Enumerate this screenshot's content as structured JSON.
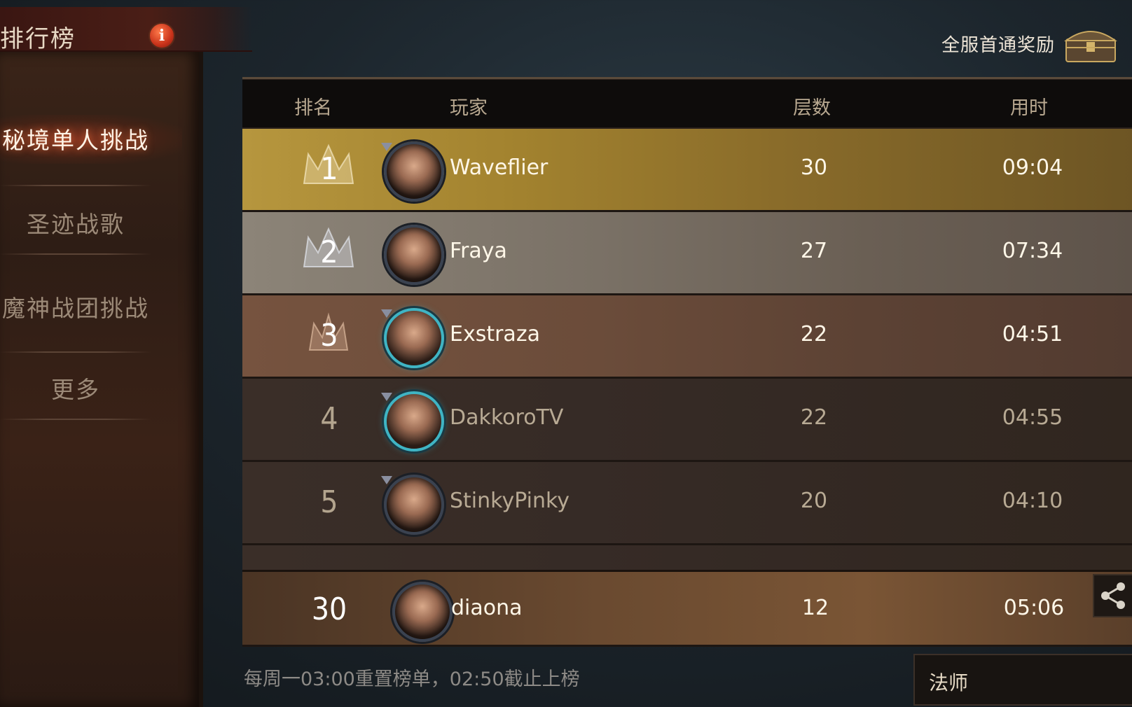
{
  "title": "排行榜",
  "reward_link": "全服首通奖励",
  "sidebar": {
    "items": [
      {
        "label": "秘境单人挑战"
      },
      {
        "label": "圣迹战歌"
      },
      {
        "label": "魔神战团挑战"
      },
      {
        "label": "更多"
      }
    ]
  },
  "table": {
    "headers": {
      "rank": "排名",
      "player": "玩家",
      "floors": "层数",
      "time": "用时"
    },
    "rows": [
      {
        "rank": "1",
        "player": "Waveflier",
        "floors": "30",
        "time": "09:04"
      },
      {
        "rank": "2",
        "player": "Fraya",
        "floors": "27",
        "time": "07:34"
      },
      {
        "rank": "3",
        "player": "Exstraza",
        "floors": "22",
        "time": "04:51"
      },
      {
        "rank": "4",
        "player": "DakkoroTV",
        "floors": "22",
        "time": "04:55"
      },
      {
        "rank": "5",
        "player": "StinkyPinky",
        "floors": "20",
        "time": "04:10"
      }
    ],
    "my_row": {
      "rank": "30",
      "player": "diaona",
      "floors": "12",
      "time": "05:06"
    }
  },
  "footer_note": "每周一03:00重置榜单，02:50截止上榜",
  "class_filter": {
    "selected": "法师"
  },
  "colors": {
    "gold": "#b6963e",
    "silver": "#8c8478",
    "bronze": "#76533f",
    "accent_red": "#c8321a"
  },
  "icons": [
    "info-icon",
    "chest-icon",
    "crown-icon",
    "share-icon"
  ]
}
